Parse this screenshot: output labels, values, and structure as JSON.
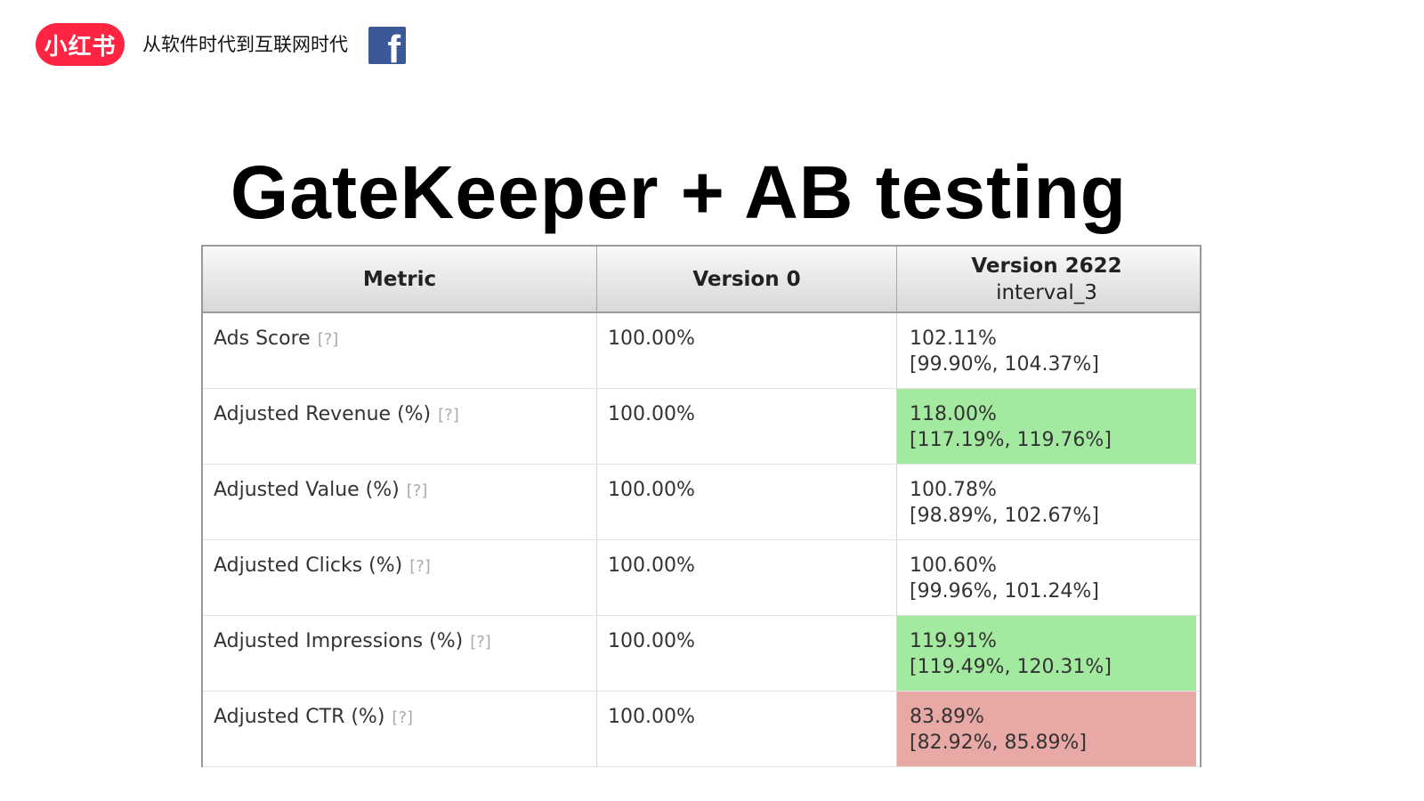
{
  "header": {
    "logo_text": "小红书",
    "tagline": "从软件时代到互联网时代",
    "facebook_glyph": "f"
  },
  "title": "GateKeeper +  AB testing",
  "table": {
    "columns": {
      "metric": "Metric",
      "control": "Version 0",
      "variant": "Version 2622",
      "variant_sub": "interval_3"
    },
    "help_marker": "[?]",
    "rows": [
      {
        "metric": "Ads Score",
        "control": "100.00%",
        "value": "102.11%",
        "ci": "[99.90%, 104.37%]",
        "status": "neutral"
      },
      {
        "metric": "Adjusted Revenue (%)",
        "control": "100.00%",
        "value": "118.00%",
        "ci": "[117.19%, 119.76%]",
        "status": "positive"
      },
      {
        "metric": "Adjusted Value (%)",
        "control": "100.00%",
        "value": "100.78%",
        "ci": "[98.89%, 102.67%]",
        "status": "neutral"
      },
      {
        "metric": "Adjusted Clicks (%)",
        "control": "100.00%",
        "value": "100.60%",
        "ci": "[99.96%, 101.24%]",
        "status": "neutral"
      },
      {
        "metric": "Adjusted Impressions (%)",
        "control": "100.00%",
        "value": "119.91%",
        "ci": "[119.49%, 120.31%]",
        "status": "positive"
      },
      {
        "metric": "Adjusted CTR (%)",
        "control": "100.00%",
        "value": "83.89%",
        "ci": "[82.92%, 85.89%]",
        "status": "negative"
      }
    ]
  },
  "colors": {
    "brand_red": "#ff2442",
    "facebook_blue": "#3b5998",
    "positive": "#a3e9a0",
    "negative": "#e8a8a5"
  }
}
